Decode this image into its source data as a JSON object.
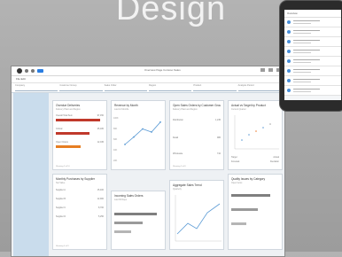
{
  "hero": {
    "title": "Design"
  },
  "window": {
    "title": "Overview Page  Contoso Sales",
    "menu": "File   Edit",
    "filters": [
      "Company",
      "Customer Group",
      "Sales Order",
      "Region",
      "Product",
      "Analysis Period"
    ]
  },
  "cards": {
    "overdue": {
      "title": "Overdue Deliveries",
      "subtitle": "Delivery Plant and Region",
      "rows": [
        {
          "label": "Overall Total Sum",
          "value": "97,450"
        },
        {
          "label": "Critical",
          "value": "25,180"
        },
        {
          "label": "Open Orders",
          "value": "12,045"
        }
      ],
      "footer": "Showing 3 of 10"
    },
    "revenue": {
      "title": "Revenue by Month",
      "subtitle": "Last 12 Months",
      "ylabels": [
        "100K",
        "80K",
        "60K",
        "40K",
        "20K"
      ],
      "points": [
        30,
        42,
        55,
        50,
        66
      ]
    },
    "bookings": {
      "title": "Open Sales Orders by Customer Group",
      "subtitle": "Delivery Plant and Region",
      "rows": [
        {
          "label": "Distribution",
          "value": "1,245"
        },
        {
          "label": "Retail",
          "value": "986"
        },
        {
          "label": "Wholesale",
          "value": "742"
        }
      ],
      "footer": "Showing 3 of 8"
    },
    "scatter": {
      "title": "Actual vs Target by Product",
      "subtitle": "Current Quarter",
      "legend": [
        "Target",
        "Actual",
        "Forecast",
        "Deviation"
      ]
    },
    "margin": {
      "title": "Monthly Purchases by Supplier",
      "subtitle": "Net Value",
      "rows": [
        {
          "label": "Supplier A",
          "value": "15,400"
        },
        {
          "label": "Supplier B",
          "value": "12,900"
        },
        {
          "label": "Supplier C",
          "value": "8,700"
        },
        {
          "label": "Supplier D",
          "value": "5,250"
        }
      ],
      "footer": "Showing 4 of 9"
    },
    "topcust": {
      "title": "Incoming Sales Orders",
      "subtitle": "Last 30 Days",
      "levels": [
        0.9,
        0.6,
        0.35
      ]
    },
    "trend": {
      "title": "Aggregate Sales Trend",
      "subtitle": "Quarterly"
    },
    "quality": {
      "title": "Quality Issues by Category",
      "subtitle": "Open Items",
      "levels": [
        0.8,
        0.55,
        0.3
      ]
    }
  },
  "colors": {
    "critical": "#c0392b",
    "warning": "#e67e22",
    "accent": "#2a7de1"
  },
  "phone": {
    "header": "Overview"
  }
}
